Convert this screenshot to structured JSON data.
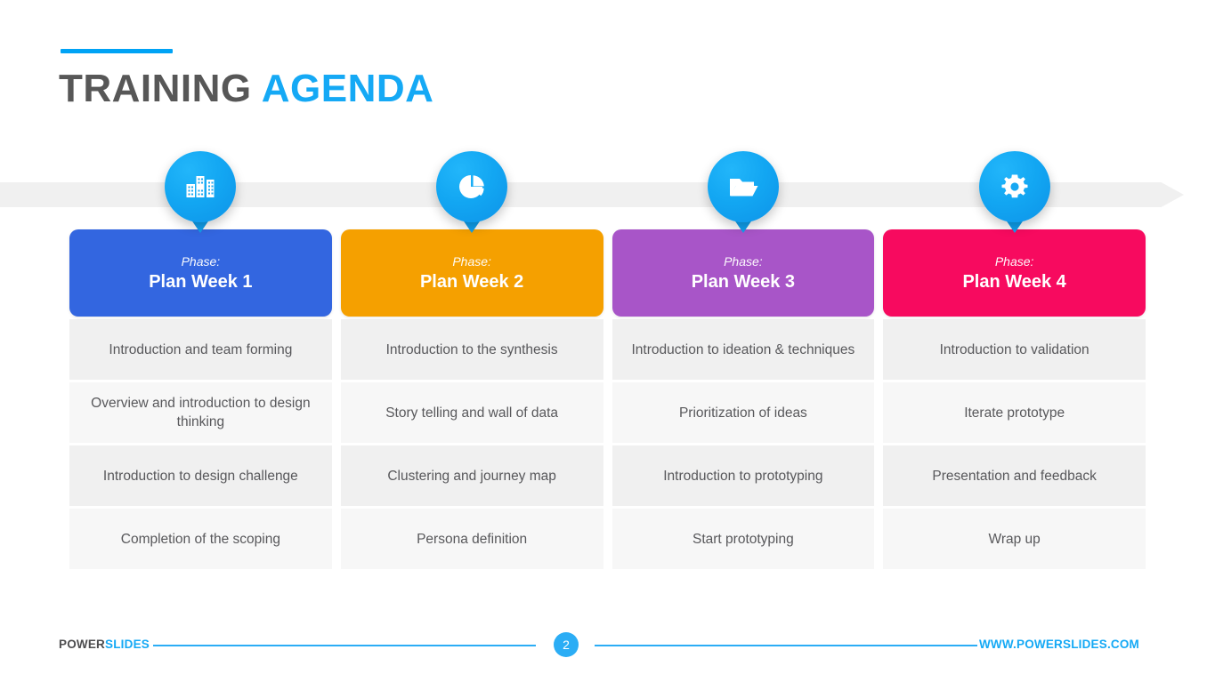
{
  "title": {
    "main": "TRAINING",
    "accent": "AGENDA",
    "accent_color": "#15A9F5"
  },
  "timeline": {
    "bar_color": "#f0f0f0",
    "direction": "right"
  },
  "columns": [
    {
      "icon": "buildings-icon",
      "phase_label": "Phase:",
      "phase_name": "Plan Week 1",
      "header_color": "#3366E0",
      "rows": [
        "Introduction and team forming",
        "Overview and introduction to design thinking",
        "Introduction to design challenge",
        "Completion of the scoping"
      ]
    },
    {
      "icon": "pie-chart-icon",
      "phase_label": "Phase:",
      "phase_name": "Plan Week 2",
      "header_color": "#F5A000",
      "rows": [
        "Introduction to the synthesis",
        "Story telling and wall of data",
        "Clustering and journey map",
        "Persona definition"
      ]
    },
    {
      "icon": "open-folder-icon",
      "phase_label": "Phase:",
      "phase_name": "Plan Week 3",
      "header_color": "#A855C8",
      "rows": [
        "Introduction to ideation & techniques",
        "Prioritization of ideas",
        "Introduction to prototyping",
        "Start prototyping"
      ]
    },
    {
      "icon": "gear-icon",
      "phase_label": "Phase:",
      "phase_name": "Plan Week 4",
      "header_color": "#F70A5F",
      "rows": [
        "Introduction to validation",
        "Iterate prototype",
        "Presentation and feedback",
        "Wrap up"
      ]
    }
  ],
  "footer": {
    "brand_primary": "POWER",
    "brand_accent": "SLIDES",
    "page_number": "2",
    "url": "WWW.POWERSLIDES.COM",
    "accent_color": "#15A9F5"
  }
}
